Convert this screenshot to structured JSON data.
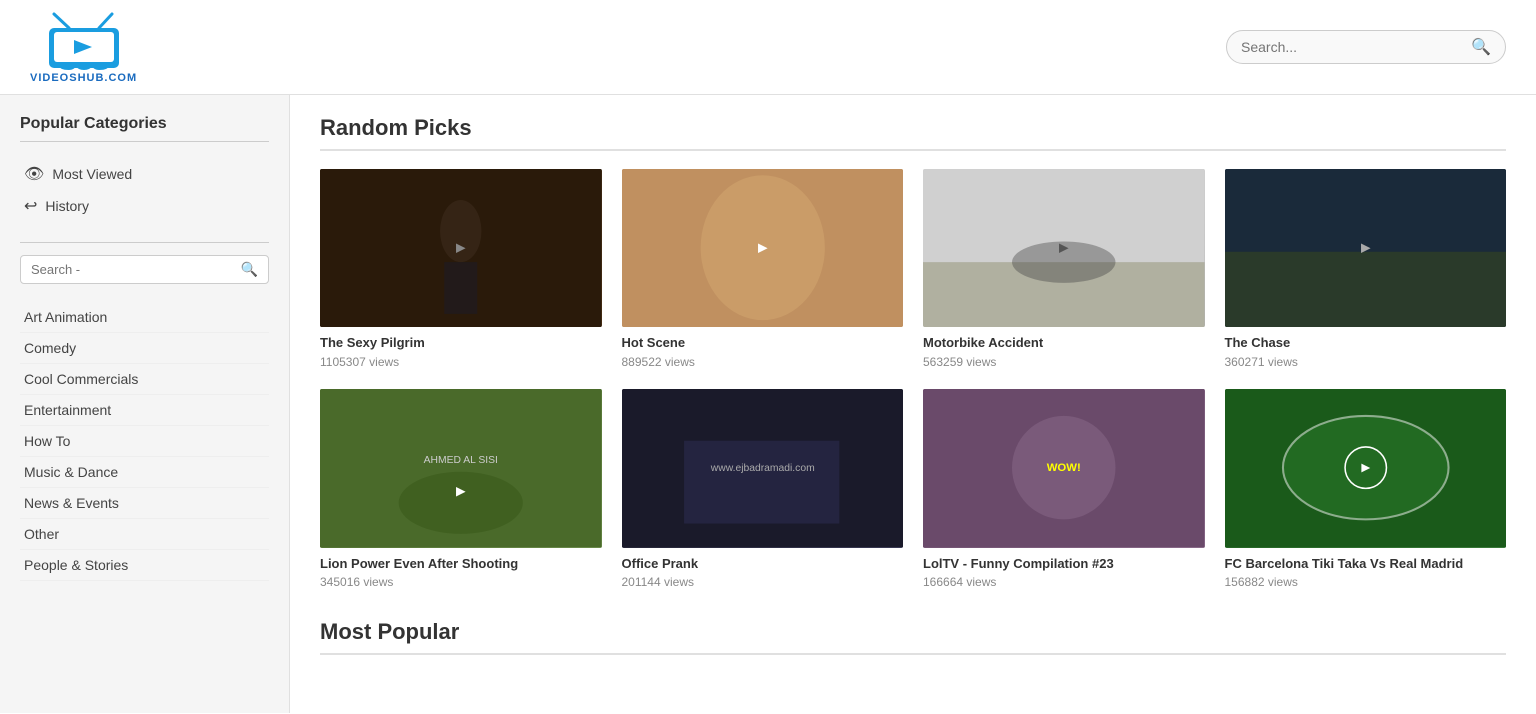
{
  "header": {
    "logo_alt": "VideosHub.com",
    "logo_text": "VIDEOSHUB.COM",
    "search_placeholder": "Search..."
  },
  "sidebar": {
    "title": "Popular Categories",
    "nav_items": [
      {
        "label": "Most Viewed",
        "icon": "👁"
      },
      {
        "label": "History",
        "icon": "↩"
      }
    ],
    "search_placeholder": "Search -",
    "categories": [
      "Art Animation",
      "Comedy",
      "Cool Commercials",
      "Entertainment",
      "How To",
      "Music & Dance",
      "News & Events",
      "Other",
      "People & Stories"
    ]
  },
  "random_picks": {
    "section_title": "Random Picks",
    "videos": [
      {
        "id": "sexy-pilgrim",
        "title": "The Sexy Pilgrim",
        "views": "1105307 views",
        "thumb_class": "thumb-sexy-pilgrim"
      },
      {
        "id": "hot-scene",
        "title": "Hot Scene",
        "views": "889522 views",
        "thumb_class": "thumb-hot-scene"
      },
      {
        "id": "motorbike-accident",
        "title": "Motorbike Accident",
        "views": "563259 views",
        "thumb_class": "thumb-motorbike"
      },
      {
        "id": "the-chase",
        "title": "The Chase",
        "views": "360271 views",
        "thumb_class": "thumb-chase"
      },
      {
        "id": "lion-power",
        "title": "Lion Power Even After Shooting",
        "views": "345016 views",
        "thumb_class": "thumb-lion"
      },
      {
        "id": "office-prank",
        "title": "Office Prank",
        "views": "201144 views",
        "thumb_class": "thumb-office-prank"
      },
      {
        "id": "loltv",
        "title": "LolTV - Funny Compilation #23",
        "views": "166664 views",
        "thumb_class": "thumb-loltv"
      },
      {
        "id": "barca",
        "title": "FC Barcelona Tiki Taka Vs Real Madrid",
        "views": "156882 views",
        "thumb_class": "thumb-barca"
      }
    ]
  },
  "most_popular": {
    "section_title": "Most Popular"
  }
}
